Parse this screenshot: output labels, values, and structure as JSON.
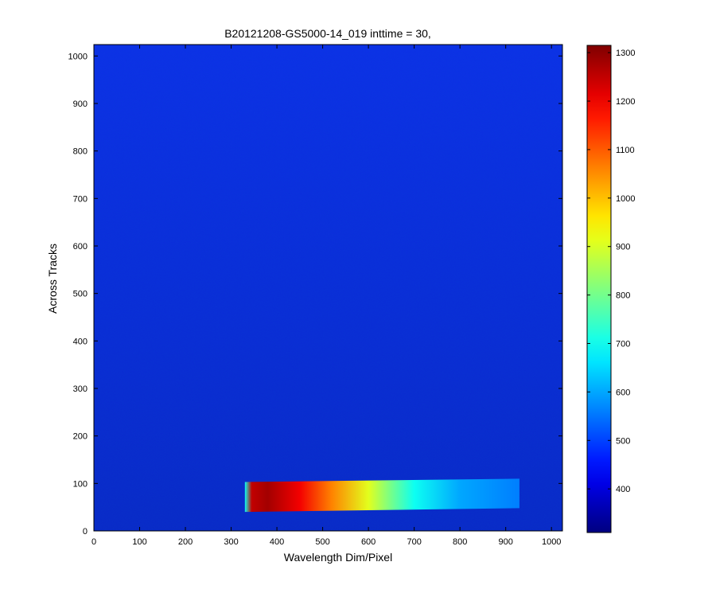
{
  "chart_data": {
    "type": "heatmap",
    "title": "B20121208-GS5000-14_019 inttime = 30,",
    "xlabel": "Wavelength Dim/Pixel",
    "ylabel": "Across Tracks",
    "xlim": [
      0,
      1024
    ],
    "ylim": [
      0,
      1024
    ],
    "xticks": [
      0,
      100,
      200,
      300,
      400,
      500,
      600,
      700,
      800,
      900,
      1000
    ],
    "yticks": [
      0,
      100,
      200,
      300,
      400,
      500,
      600,
      700,
      800,
      900,
      1000
    ],
    "colorbar": {
      "range": [
        310,
        1315
      ],
      "ticks": [
        400,
        500,
        600,
        700,
        800,
        900,
        1000,
        1100,
        1200,
        1300
      ],
      "colormap": "jet"
    },
    "background_value": 400,
    "features": [
      {
        "name": "signal band",
        "x_range": [
          330,
          930
        ],
        "y_range_start": [
          40,
          103
        ],
        "y_range_end": [
          48,
          110
        ],
        "profile_x": [
          330,
          345,
          380,
          450,
          520,
          600,
          650,
          700,
          800,
          930
        ],
        "profile_values": [
          700,
          1250,
          1280,
          1200,
          1060,
          910,
          800,
          700,
          600,
          560
        ]
      }
    ]
  }
}
